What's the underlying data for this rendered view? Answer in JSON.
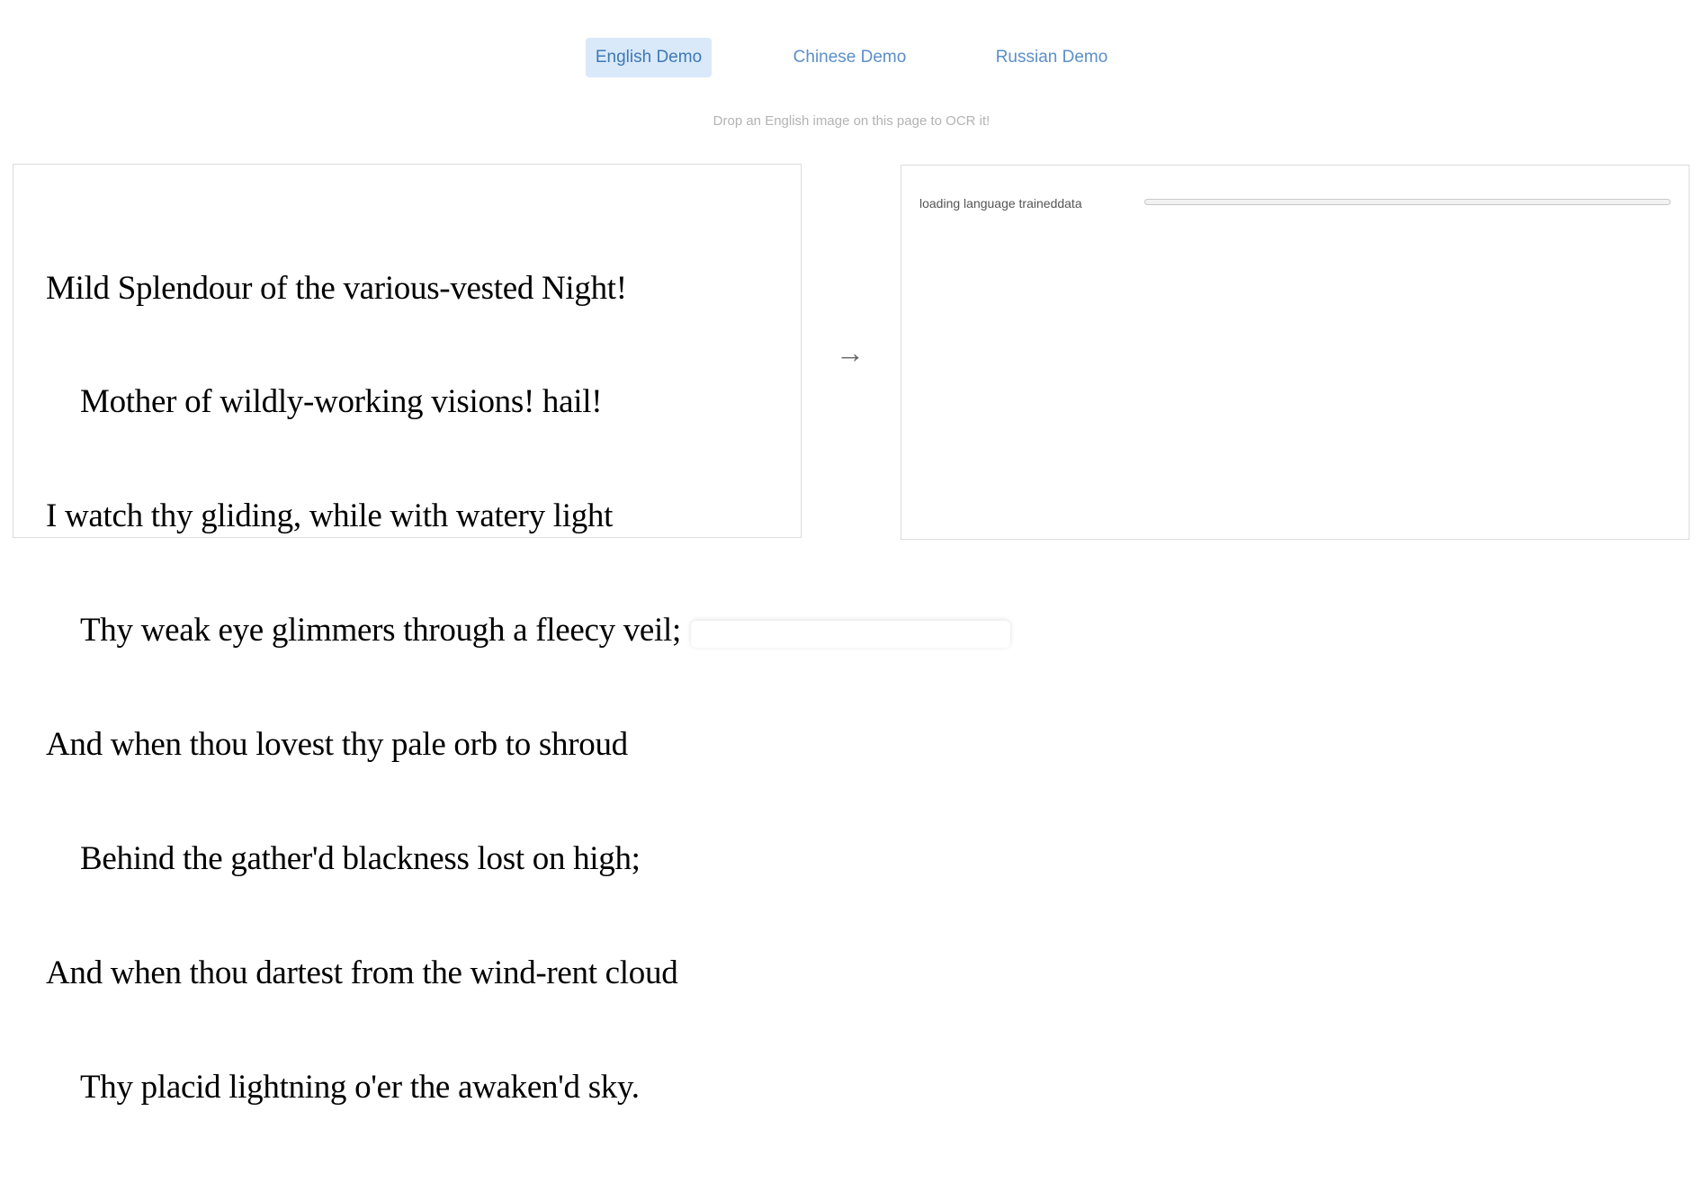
{
  "tabs": [
    {
      "label": "English Demo",
      "active": true
    },
    {
      "label": "Chinese Demo",
      "active": false
    },
    {
      "label": "Russian Demo",
      "active": false
    }
  ],
  "hint": "Drop an English image on this page to OCR it!",
  "input_image": {
    "lines": [
      "Mild Splendour of the various-vested Night!",
      "Mother of wildly-working visions! hail!",
      "I watch thy gliding, while with watery light",
      "Thy weak eye glimmers through a fleecy veil;",
      "And when thou lovest thy pale orb to shroud",
      "Behind the gather'd blackness lost on high;",
      "And when thou dartest from the wind-rent cloud",
      "Thy placid lightning o'er the awaken'd sky."
    ]
  },
  "arrow": "→",
  "output": {
    "status_label": "loading language traineddata",
    "progress": 0
  },
  "colors": {
    "accent": "#5b8fc9",
    "active_tab_bg": "#d9e9fa"
  }
}
